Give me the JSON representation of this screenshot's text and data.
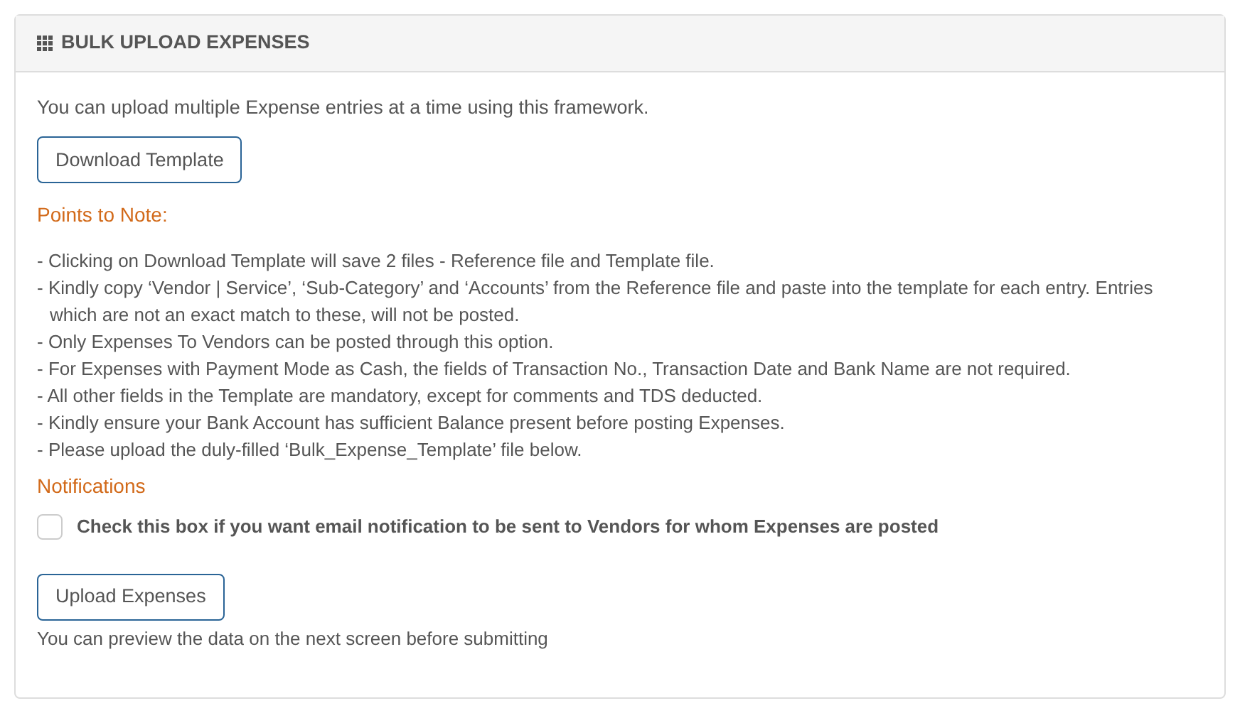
{
  "panel": {
    "title": "BULK UPLOAD EXPENSES"
  },
  "intro": "You can upload multiple Expense entries at a time using this framework.",
  "download_button": "Download Template",
  "notes_heading": "Points to Note:",
  "notes": [
    "- Clicking on Download Template will save 2 files - Reference file and Template file.",
    "- Kindly copy ‘Vendor | Service’, ‘Sub-Category’ and ‘Accounts’ from the Reference file and paste into the template for each entry. Entries which are not an exact match to these, will not be posted.",
    "- Only Expenses To Vendors can be posted through this option.",
    "- For Expenses with Payment Mode as Cash, the fields of Transaction No., Transaction Date and Bank Name are not required.",
    "- All other fields in the Template are mandatory, except for comments and TDS deducted.",
    "- Kindly ensure your Bank Account has sufficient Balance present before posting Expenses.",
    "- Please upload the duly-filled ‘Bulk_Expense_Template’ file below."
  ],
  "notifications_heading": "Notifications",
  "notification_option": {
    "label": "Check this box if you want email notification to be sent to Vendors for whom Expenses are posted",
    "checked": false
  },
  "upload_button": "Upload Expenses",
  "footer_note": "You can preview the data on the next screen before submitting"
}
